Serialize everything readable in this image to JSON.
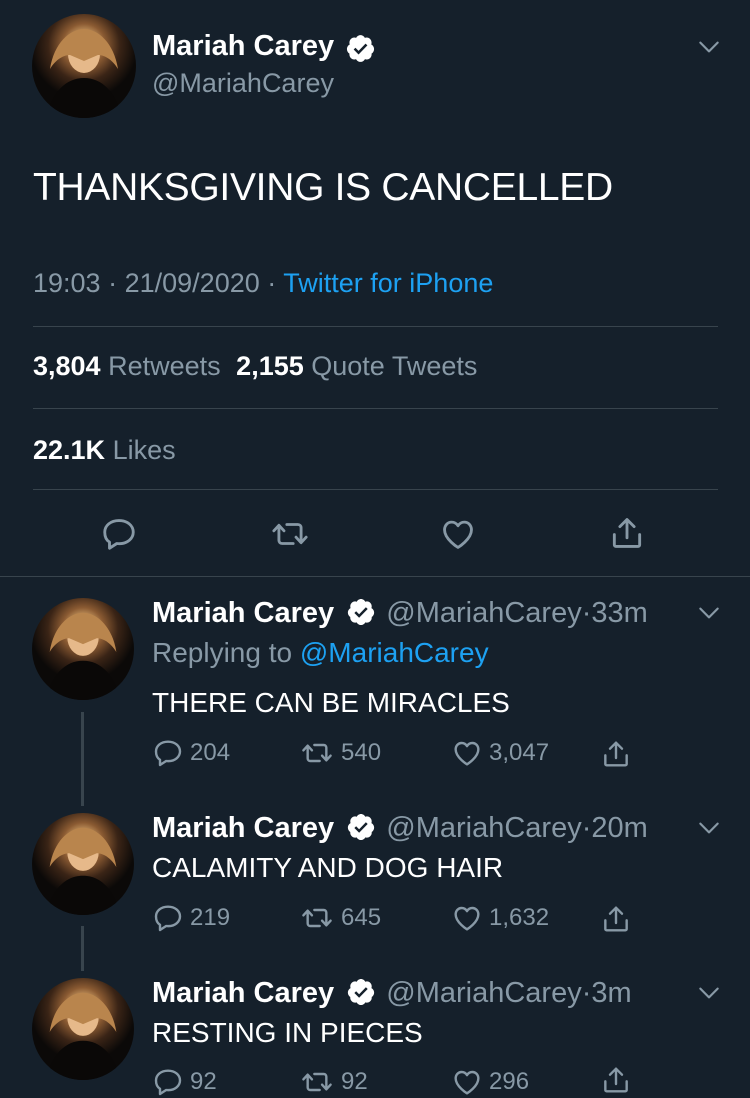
{
  "main_tweet": {
    "author_name": "Mariah Carey",
    "author_handle": "@MariahCarey",
    "text": "THANKSGIVING IS CANCELLED",
    "time": "19:03",
    "date": "21/09/2020",
    "separator": "·",
    "source": "Twitter for iPhone",
    "retweets_count": "3,804",
    "retweets_label": "Retweets",
    "quote_count": "2,155",
    "quote_label": "Quote Tweets",
    "likes_count": "22.1K",
    "likes_label": "Likes"
  },
  "replies": [
    {
      "author_name": "Mariah Carey",
      "author_handle": "@MariahCarey",
      "age": "33m",
      "replying_prefix": "Replying to",
      "replying_to": "@MariahCarey",
      "text": "THERE CAN BE MIRACLES",
      "reply_count": "204",
      "retweet_count": "540",
      "like_count": "3,047"
    },
    {
      "author_name": "Mariah Carey",
      "author_handle": "@MariahCarey",
      "age": "20m",
      "text": "CALAMITY AND DOG HAIR",
      "reply_count": "219",
      "retweet_count": "645",
      "like_count": "1,632"
    },
    {
      "author_name": "Mariah Carey",
      "author_handle": "@MariahCarey",
      "age": "3m",
      "text": "RESTING IN PIECES",
      "reply_count": "92",
      "retweet_count": "92",
      "like_count": "296"
    }
  ],
  "colors": {
    "background": "#15202b",
    "accent": "#1da1f2",
    "muted": "#8899a6",
    "divider": "#38444d"
  },
  "icons": [
    "verified-badge-icon",
    "chevron-down-icon",
    "reply-icon",
    "retweet-icon",
    "like-icon",
    "share-icon"
  ]
}
